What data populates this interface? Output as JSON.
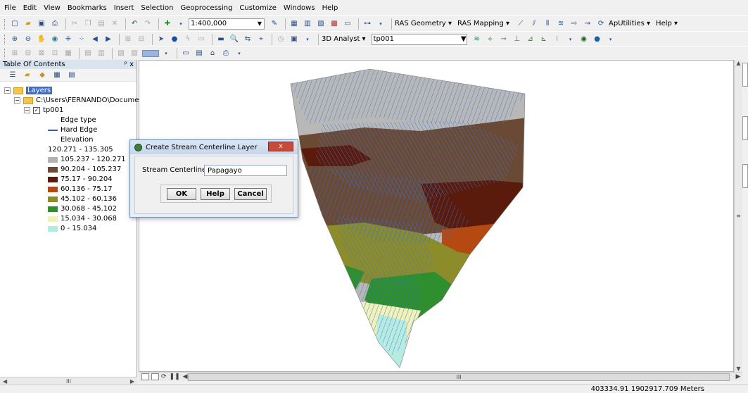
{
  "menu": [
    "File",
    "Edit",
    "View",
    "Bookmarks",
    "Insert",
    "Selection",
    "Geoprocessing",
    "Customize",
    "Windows",
    "Help"
  ],
  "toolbar1": {
    "scale": "1:400,000",
    "ras_geometry": "RAS Geometry ▾",
    "ras_mapping": "RAS Mapping ▾",
    "aputilities": "ApUtilities ▾",
    "help": "Help ▾"
  },
  "toolbar2": {
    "analyst": "3D Analyst ▾",
    "layer": "tp001"
  },
  "toc": {
    "title": "Table Of Contents",
    "pin": "ᵖ x",
    "layers_label": "Layers",
    "path": "C:\\Users\\FERNANDO\\Document",
    "layer_name": "tp001",
    "edge_type": "Edge type",
    "hard_edge": "Hard Edge",
    "elevation": "Elevation",
    "classes": [
      {
        "label": "120.271 - 135.305",
        "color": "#ffffff"
      },
      {
        "label": "105.237 - 120.271",
        "color": "#b2b2b2"
      },
      {
        "label": "90.204 - 105.237",
        "color": "#6b4a35"
      },
      {
        "label": "75.17 - 90.204",
        "color": "#5a1a0c"
      },
      {
        "label": "60.136 - 75.17",
        "color": "#b44a12"
      },
      {
        "label": "45.102 - 60.136",
        "color": "#8c8c2a"
      },
      {
        "label": "30.068 - 45.102",
        "color": "#2f8f2f"
      },
      {
        "label": "15.034 - 30.068",
        "color": "#f2f2b8"
      },
      {
        "label": "0 - 15.034",
        "color": "#b2ece0"
      }
    ],
    "scroll_thumb": "III"
  },
  "dialog": {
    "title": "Create Stream Centerline Layer",
    "close": "x",
    "field_label": "Stream Centerline",
    "field_value": "Papagayo",
    "ok": "OK",
    "help": "Help",
    "cancel": "Cancel"
  },
  "map_scroll_thumb": "III",
  "status": {
    "coords": "403334.91  1902917.709 Meters"
  }
}
